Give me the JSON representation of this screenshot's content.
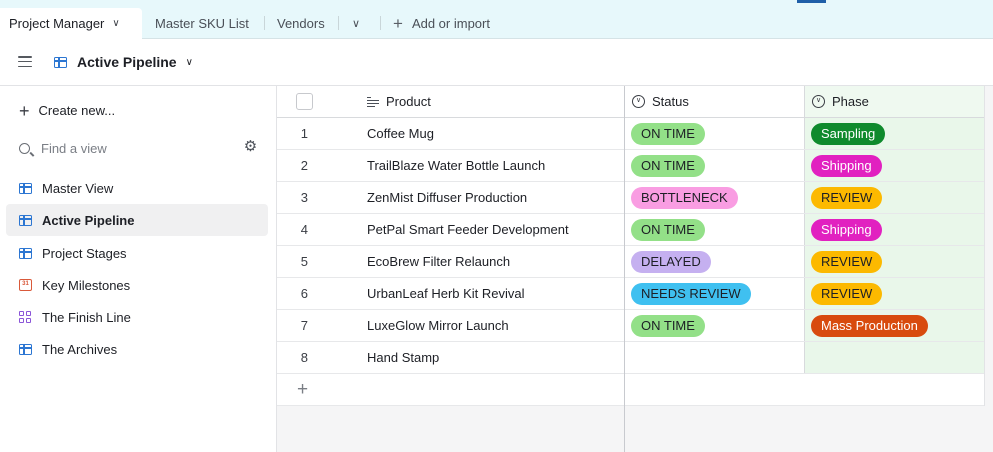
{
  "tabs": {
    "active_label": "Project Manager",
    "items": [
      "Master SKU List",
      "Vendors"
    ],
    "add_label": "Add or import"
  },
  "view": {
    "current": "Active Pipeline"
  },
  "sidebar": {
    "create_label": "Create new...",
    "find_placeholder": "Find a view",
    "items": [
      {
        "label": "Master View",
        "icon": "grid-icon",
        "active": false
      },
      {
        "label": "Active Pipeline",
        "icon": "grid-icon",
        "active": true
      },
      {
        "label": "Project Stages",
        "icon": "grid-icon",
        "active": false
      },
      {
        "label": "Key Milestones",
        "icon": "calendar-icon",
        "active": false
      },
      {
        "label": "The Finish Line",
        "icon": "gallery-icon",
        "active": false
      },
      {
        "label": "The Archives",
        "icon": "grid-icon",
        "active": false
      }
    ]
  },
  "table": {
    "columns": {
      "product": "Product",
      "status": "Status",
      "phase": "Phase"
    },
    "rows": [
      {
        "num": "1",
        "product": "Coffee Mug",
        "status": "ON TIME",
        "phase": "Sampling"
      },
      {
        "num": "2",
        "product": "TrailBlaze Water Bottle Launch",
        "status": "ON TIME",
        "phase": "Shipping"
      },
      {
        "num": "3",
        "product": "ZenMist Diffuser Production",
        "status": "BOTTLENECK",
        "phase": "REVIEW"
      },
      {
        "num": "4",
        "product": "PetPal Smart Feeder Development",
        "status": "ON TIME",
        "phase": "Shipping"
      },
      {
        "num": "5",
        "product": "EcoBrew Filter Relaunch",
        "status": "DELAYED",
        "phase": "REVIEW"
      },
      {
        "num": "6",
        "product": "UrbanLeaf Herb Kit Revival",
        "status": "NEEDS REVIEW",
        "phase": "REVIEW"
      },
      {
        "num": "7",
        "product": "LuxeGlow Mirror Launch",
        "status": "ON TIME",
        "phase": "Mass Production"
      },
      {
        "num": "8",
        "product": "Hand Stamp",
        "status": "",
        "phase": ""
      }
    ],
    "status_colors": {
      "ON TIME": "#93e088",
      "BOTTLENECK": "#f99de2",
      "DELAYED": "#c5b0f0",
      "NEEDS REVIEW": "#3fc0f0"
    },
    "phase_colors": {
      "Sampling": "#0f8a2d",
      "Shipping": "#e121c0",
      "REVIEW": "#fcb900",
      "Mass Production": "#d84b0e"
    }
  }
}
